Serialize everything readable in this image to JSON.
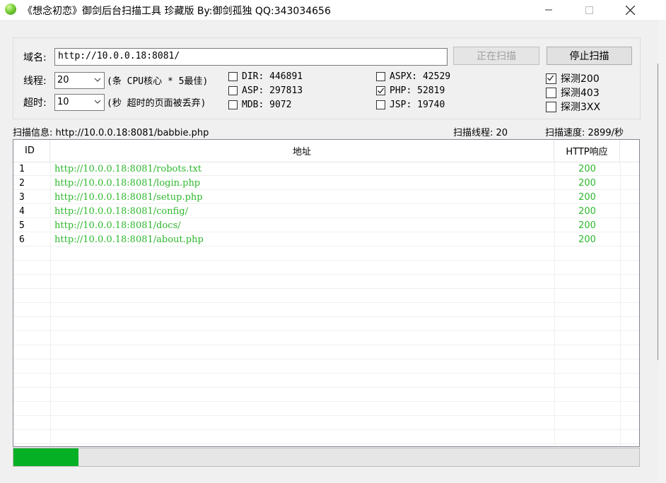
{
  "window": {
    "title": "《想念初恋》御剑后台扫描工具 珍藏版 By:御剑孤独 QQ:343034656",
    "controls": {
      "minimize": "—",
      "maximize": "☐",
      "close": "✕"
    }
  },
  "form": {
    "domain_label": "域名:",
    "domain_value": "http://10.0.0.18:8081/",
    "threads_label": "线程:",
    "threads_value": "20",
    "threads_hint": "(条 CPU核心 * 5最佳)",
    "timeout_label": "超时:",
    "timeout_value": "10",
    "timeout_hint": "(秒 超时的页面被丢弃)",
    "scanning_button": "正在扫描",
    "stop_button": "停止扫描"
  },
  "dictionaries": [
    {
      "label": "DIR: 446891",
      "checked": false
    },
    {
      "label": "ASP: 297813",
      "checked": false
    },
    {
      "label": "MDB: 9072",
      "checked": false
    },
    {
      "label": "ASPX: 42529",
      "checked": false
    },
    {
      "label": "PHP: 52819",
      "checked": true
    },
    {
      "label": "JSP: 19740",
      "checked": false
    }
  ],
  "probes": [
    {
      "label": "探测200",
      "checked": true
    },
    {
      "label": "探测403",
      "checked": false
    },
    {
      "label": "探测3XX",
      "checked": false
    }
  ],
  "status": {
    "scan_info": "扫描信息: http://10.0.0.18:8081/babbie.php",
    "scan_threads": "扫描线程: 20",
    "scan_speed": "扫描速度: 2899/秒"
  },
  "table": {
    "columns": [
      "ID",
      "地址",
      "HTTP响应"
    ],
    "rows": [
      {
        "id": "1",
        "url": "http://10.0.0.18:8081/robots.txt",
        "code": "200"
      },
      {
        "id": "2",
        "url": "http://10.0.0.18:8081/login.php",
        "code": "200"
      },
      {
        "id": "3",
        "url": "http://10.0.0.18:8081/setup.php",
        "code": "200"
      },
      {
        "id": "4",
        "url": "http://10.0.0.18:8081/config/",
        "code": "200"
      },
      {
        "id": "5",
        "url": "http://10.0.0.18:8081/docs/",
        "code": "200"
      },
      {
        "id": "6",
        "url": "http://10.0.0.18:8081/about.php",
        "code": "200"
      }
    ]
  },
  "progress": {
    "fraction": 0.104,
    "color": "#06b025"
  },
  "colors": {
    "result_text": "#2eb82e",
    "window_bg": "#f0f0f0"
  }
}
